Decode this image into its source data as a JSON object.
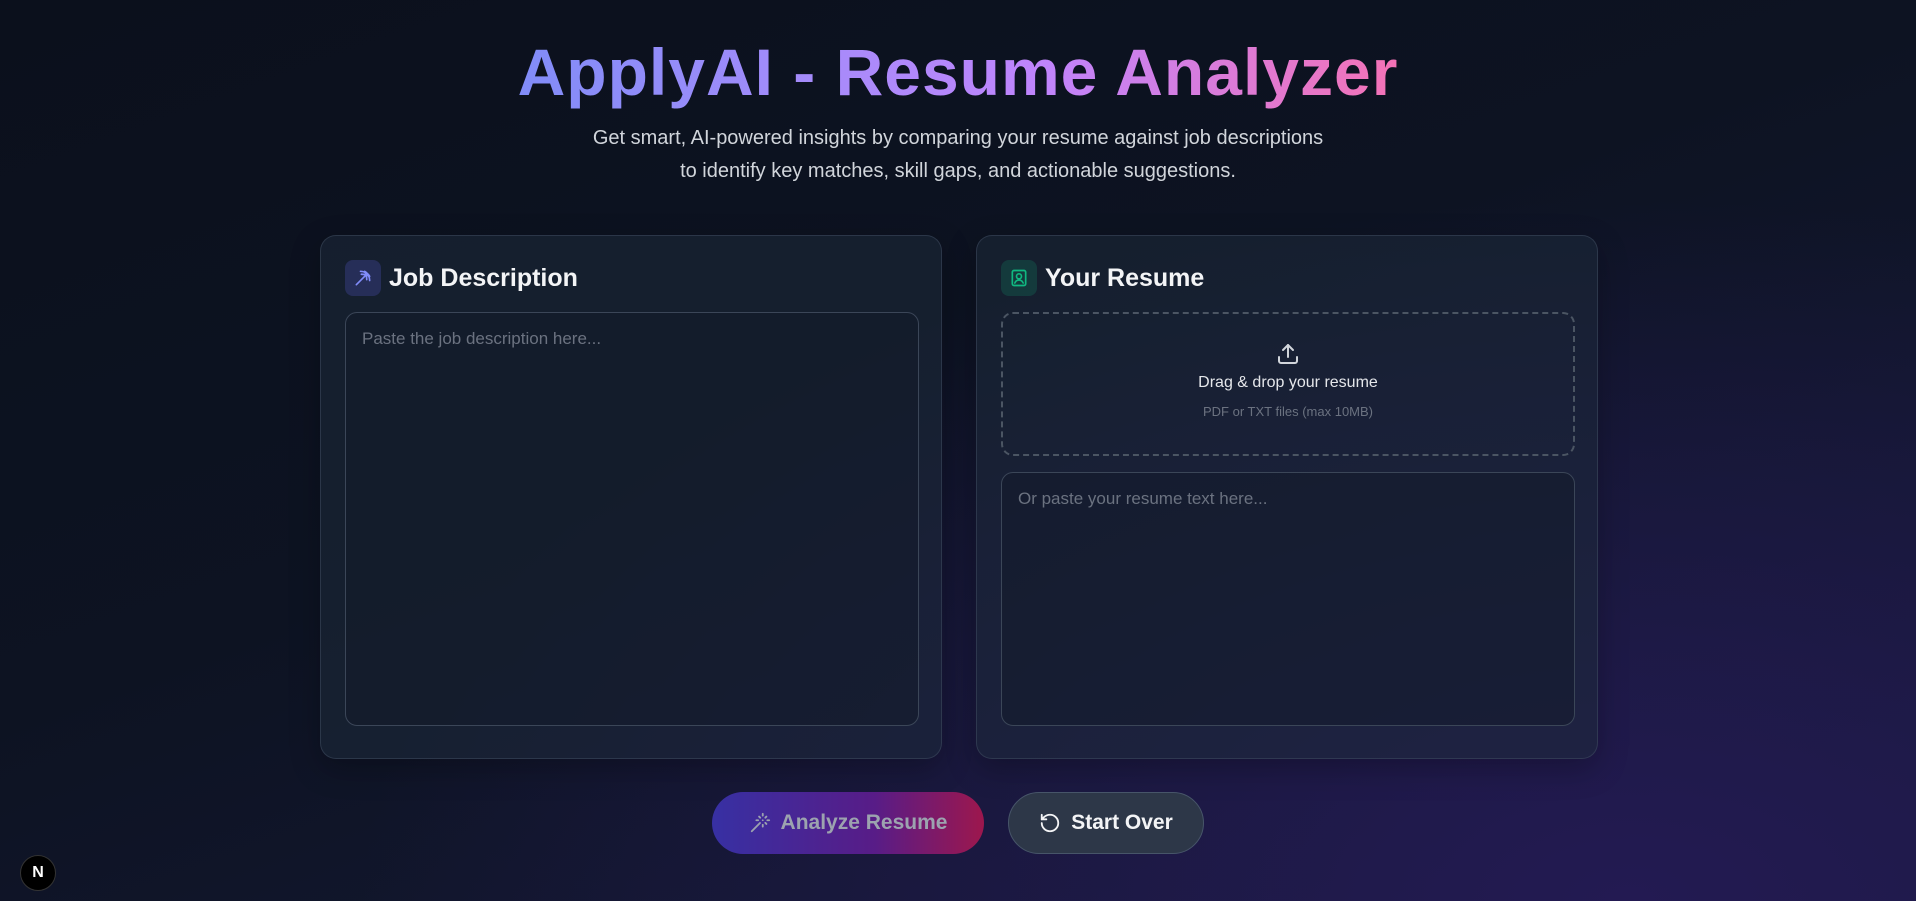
{
  "header": {
    "title": "ApplyAI - Resume Analyzer",
    "subtitle_line1": "Get smart, AI-powered insights by comparing your resume against job descriptions",
    "subtitle_line2": "to identify key matches, skill gaps, and actionable suggestions."
  },
  "job_card": {
    "title": "Job Description",
    "icon": "pickaxe-icon",
    "textarea_value": "",
    "textarea_placeholder": "Paste the job description here..."
  },
  "resume_card": {
    "title": "Your Resume",
    "icon": "contact-card-icon",
    "dropzone": {
      "icon": "upload-icon",
      "title": "Drag & drop your resume",
      "subtitle": "PDF or TXT files (max 10MB)"
    },
    "textarea_value": "",
    "textarea_placeholder": "Or paste your resume text here..."
  },
  "actions": {
    "analyze_label": "Analyze Resume",
    "analyze_icon": "magic-wand-icon",
    "reset_label": "Start Over",
    "reset_icon": "rotate-ccw-icon"
  },
  "badge": {
    "label": "N"
  },
  "colors": {
    "accent_indigo": "#818cf8",
    "accent_pink": "#f472b6",
    "resume_icon_green": "#10b981"
  }
}
